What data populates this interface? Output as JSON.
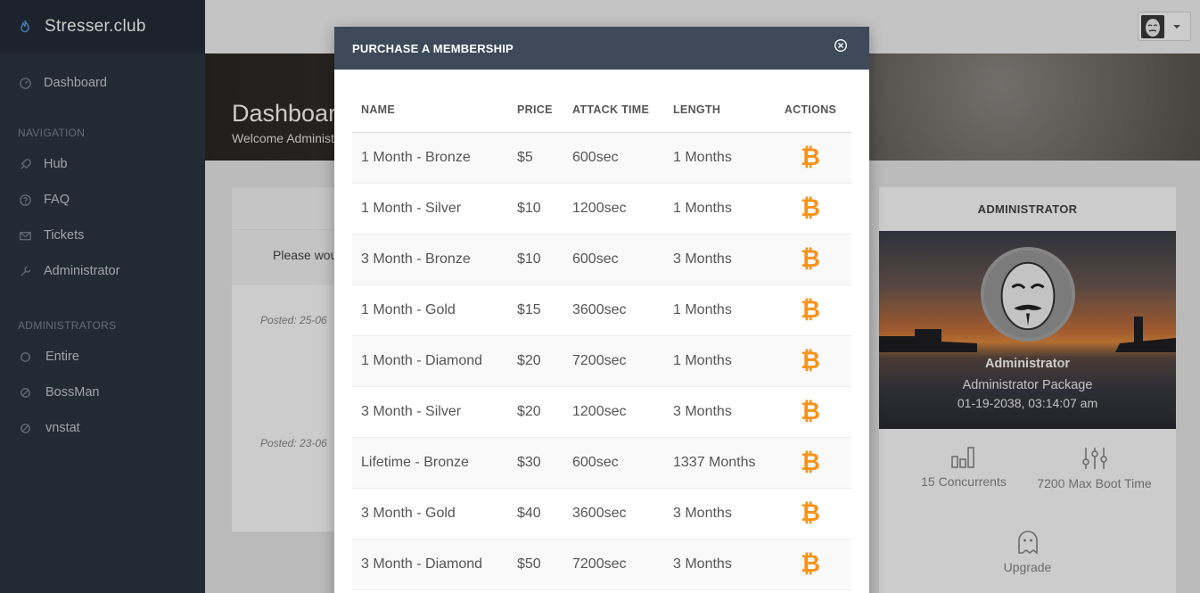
{
  "brand": {
    "name": "Stresser.club",
    "icon": "flame-icon"
  },
  "sidebar": {
    "dashboard": "Dashboard",
    "nav_heading": "NAVIGATION",
    "nav_items": [
      {
        "label": "Hub",
        "icon": "rocket-icon"
      },
      {
        "label": "FAQ",
        "icon": "help-circle-icon"
      },
      {
        "label": "Tickets",
        "icon": "envelope-icon"
      },
      {
        "label": "Administrator",
        "icon": "wrench-icon"
      }
    ],
    "admins_heading": "ADMINISTRATORS",
    "admin_items": [
      {
        "label": "Entire",
        "icon": "circle-icon"
      },
      {
        "label": "BossMan",
        "icon": "blocked-circle-icon"
      },
      {
        "label": "vnstat",
        "icon": "blocked-circle-icon"
      }
    ]
  },
  "hero": {
    "title": "Dashboard",
    "subtitle": "Welcome Administrator"
  },
  "news": {
    "notice": "Please would",
    "posts": [
      {
        "posted": "Posted: 25-06"
      },
      {
        "posted": "Posted: 23-06"
      }
    ]
  },
  "profile": {
    "heading": "ADMINISTRATOR",
    "name": "Administrator",
    "package": "Administrator Package",
    "expires": "01-19-2038, 03:14:07 am",
    "concurrents": "15 Concurrents",
    "boot_time": "7200 Max Boot Time",
    "upgrade": "Upgrade"
  },
  "modal": {
    "title": "PURCHASE A MEMBERSHIP",
    "columns": [
      "NAME",
      "PRICE",
      "ATTACK TIME",
      "LENGTH",
      "ACTIONS"
    ],
    "action_icon": "bitcoin-icon",
    "rows": [
      {
        "name": "1 Month - Bronze",
        "price": "$5",
        "attack_time": "600sec",
        "length": "1 Months"
      },
      {
        "name": "1 Month - Silver",
        "price": "$10",
        "attack_time": "1200sec",
        "length": "1 Months"
      },
      {
        "name": "3 Month - Bronze",
        "price": "$10",
        "attack_time": "600sec",
        "length": "3 Months"
      },
      {
        "name": "1 Month - Gold",
        "price": "$15",
        "attack_time": "3600sec",
        "length": "1 Months"
      },
      {
        "name": "1 Month - Diamond",
        "price": "$20",
        "attack_time": "7200sec",
        "length": "1 Months"
      },
      {
        "name": "3 Month - Silver",
        "price": "$20",
        "attack_time": "1200sec",
        "length": "3 Months"
      },
      {
        "name": "Lifetime - Bronze",
        "price": "$30",
        "attack_time": "600sec",
        "length": "1337 Months"
      },
      {
        "name": "3 Month - Gold",
        "price": "$40",
        "attack_time": "3600sec",
        "length": "3 Months"
      },
      {
        "name": "3 Month - Diamond",
        "price": "$50",
        "attack_time": "7200sec",
        "length": "3 Months"
      }
    ]
  },
  "colors": {
    "sidebar": "#2b3542",
    "modal_header": "#3e4a59",
    "bitcoin": "#f7931a"
  }
}
